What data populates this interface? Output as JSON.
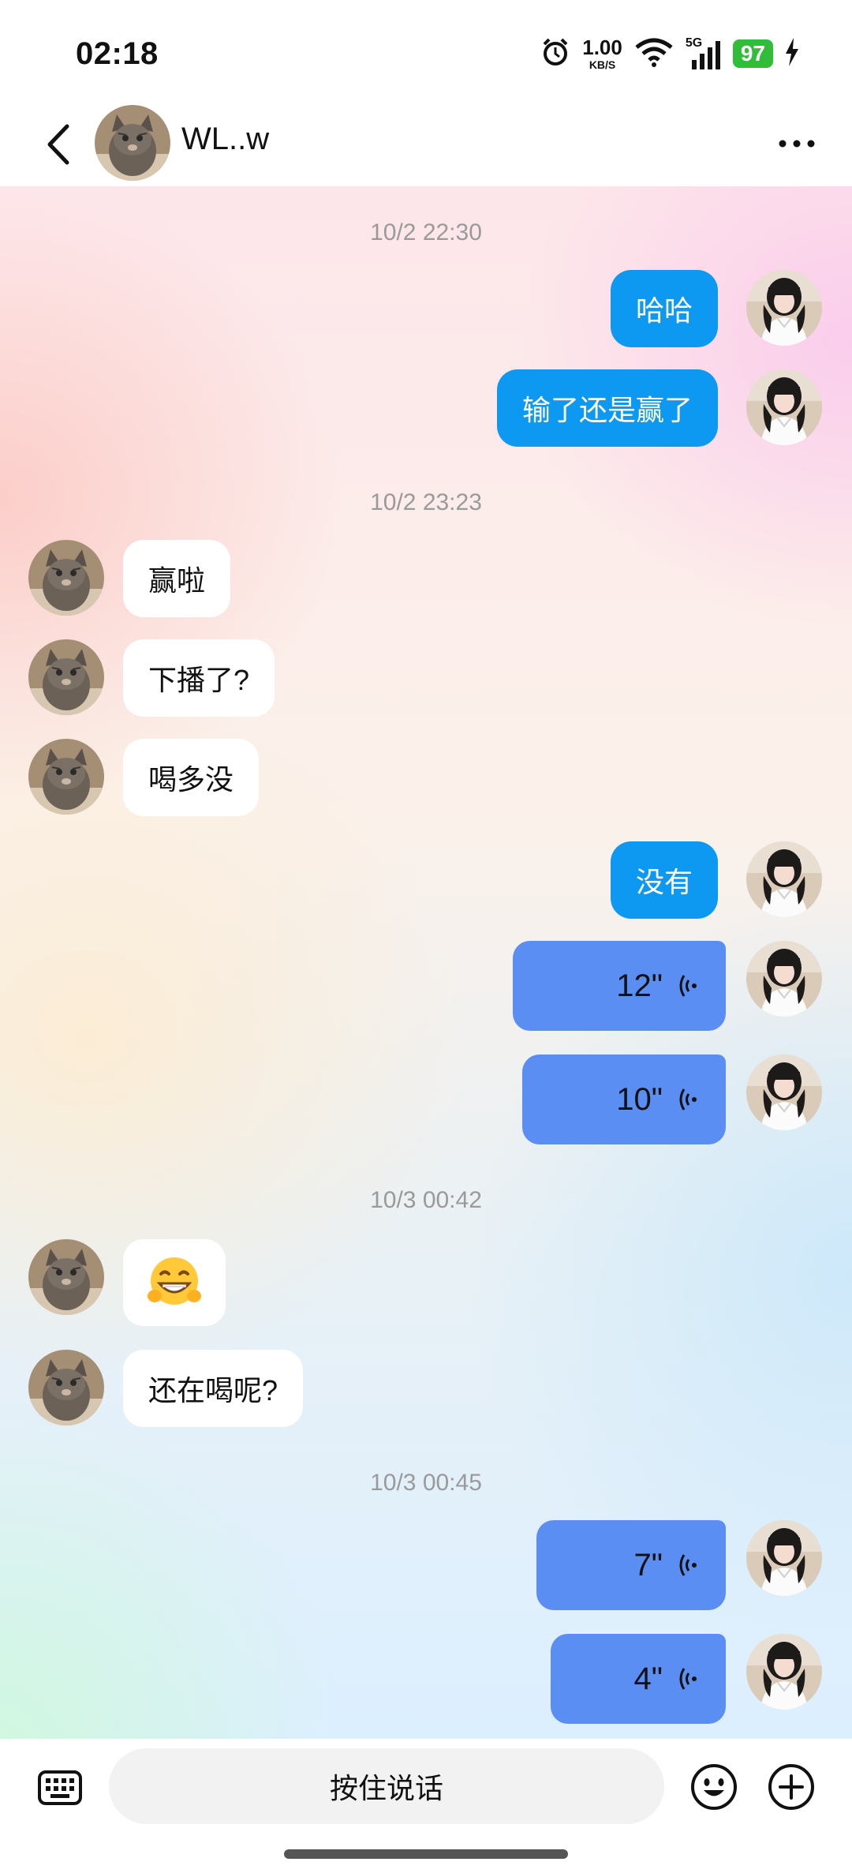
{
  "status": {
    "time": "02:18",
    "net_speed_value": "1.00",
    "net_speed_unit": "KB/S",
    "signal_label": "5G",
    "battery": "97"
  },
  "header": {
    "contact_name": "WL..w"
  },
  "messages": [
    {
      "kind": "timestamp",
      "text": "10/2 22:30"
    },
    {
      "kind": "out",
      "text": "哈哈"
    },
    {
      "kind": "out",
      "text": "输了还是赢了"
    },
    {
      "kind": "timestamp",
      "text": "10/2 23:23"
    },
    {
      "kind": "in",
      "text": "赢啦"
    },
    {
      "kind": "in",
      "text": "下播了?"
    },
    {
      "kind": "in",
      "text": "喝多没"
    },
    {
      "kind": "out",
      "text": "没有"
    },
    {
      "kind": "voice",
      "text": "12\""
    },
    {
      "kind": "voice",
      "text": "10\""
    },
    {
      "kind": "timestamp",
      "text": "10/3 00:42"
    },
    {
      "kind": "in-emoji",
      "text": "grinning-emoji"
    },
    {
      "kind": "in",
      "text": "还在喝呢?"
    },
    {
      "kind": "timestamp",
      "text": "10/3 00:45"
    },
    {
      "kind": "voice",
      "text": "7\""
    },
    {
      "kind": "voice",
      "text": "4\""
    }
  ],
  "input": {
    "hold_to_talk": "按住说话"
  },
  "icons": {
    "back": "chevron-left-icon",
    "more": "more-dots-icon",
    "keyboard": "keyboard-icon",
    "emoji": "smiley-icon",
    "plus": "plus-circle-icon",
    "voice": "sound-wave-icon"
  },
  "colors": {
    "outgoing_bubble": "#0d99f2",
    "voice_bubble": "#5b8ef2",
    "battery": "#2fbd3a"
  }
}
